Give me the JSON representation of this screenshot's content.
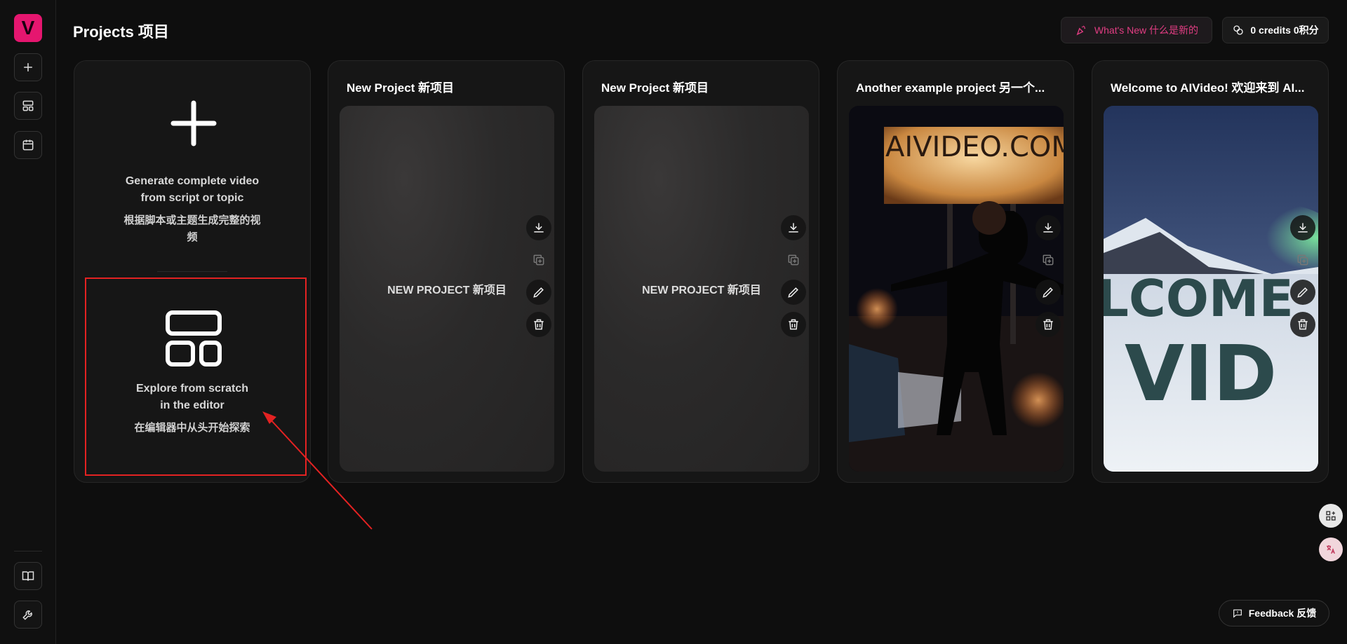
{
  "app": {
    "logo_letter": "V",
    "brand_color": "#e5166f"
  },
  "header": {
    "title": "Projects  项目",
    "whats_new": "What's New  什么是新的",
    "credits": "0 credits  0积分"
  },
  "sidebar": {
    "items": [
      {
        "icon": "plus-icon"
      },
      {
        "icon": "layout-icon"
      },
      {
        "icon": "calendar-icon"
      },
      {
        "icon": "book-icon"
      },
      {
        "icon": "wrench-icon"
      }
    ]
  },
  "create_card": {
    "generate_en": "Generate complete video from script or topic",
    "generate_zh": "根据脚本或主题生成完整的视频",
    "scratch_en": "Explore from scratch in the editor",
    "scratch_zh": "在编辑器中从头开始探索"
  },
  "projects": [
    {
      "title": "New Project  新项目",
      "thumb_label": "NEW PROJECT  新项目"
    },
    {
      "title": "New Project  新项目",
      "thumb_label": "NEW PROJECT  新项目"
    },
    {
      "title": "Another example project  另一个...",
      "thumb_label": ""
    },
    {
      "title": "Welcome to AIVideo!  欢迎来到 AI...",
      "thumb_label": ""
    }
  ],
  "thumb_text": {
    "billboard": "AIVIDEO.COM",
    "snow_line1": "LCOME",
    "snow_line2": "VID"
  },
  "feedback": {
    "label": "Feedback  反馈"
  },
  "colors": {
    "annotation_red": "#e32222",
    "accent_pink": "#e23d83"
  }
}
